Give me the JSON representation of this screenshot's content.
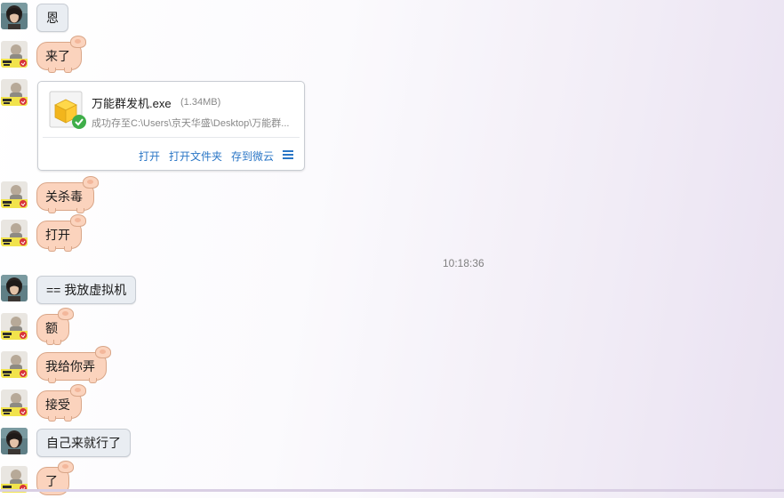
{
  "messages": [
    {
      "sender": "other",
      "text": "恩",
      "style": "gray"
    },
    {
      "sender": "me",
      "text": "来了",
      "style": "pig"
    },
    {
      "sender": "me",
      "type": "file"
    },
    {
      "sender": "me",
      "text": "关杀毒",
      "style": "pig"
    },
    {
      "sender": "me",
      "text": "打开",
      "style": "pig"
    },
    {
      "type": "time",
      "text": "10:18:36"
    },
    {
      "sender": "other",
      "text": "== 我放虚拟机",
      "style": "gray"
    },
    {
      "sender": "me",
      "text": "额",
      "style": "pig"
    },
    {
      "sender": "me",
      "text": "我给你弄",
      "style": "pig"
    },
    {
      "sender": "me",
      "text": "接受",
      "style": "pig"
    },
    {
      "sender": "other",
      "text": "自己来就行了",
      "style": "gray"
    },
    {
      "sender": "me",
      "text": "了",
      "style": "pig"
    }
  ],
  "file_card": {
    "name": "万能群发机.exe",
    "size": "(1.34MB)",
    "status": "成功存至C:\\Users\\京天华盛\\Desktop\\万能群...",
    "actions": {
      "open": "打开",
      "open_folder": "打开文件夹",
      "save_cloud": "存到微云"
    },
    "icon": "package-icon",
    "status_icon": "check-icon"
  },
  "colors": {
    "gray_bubble": "#e9edf2",
    "pig_bubble": "#fbd3bd",
    "link_blue": "#2a76c6"
  }
}
